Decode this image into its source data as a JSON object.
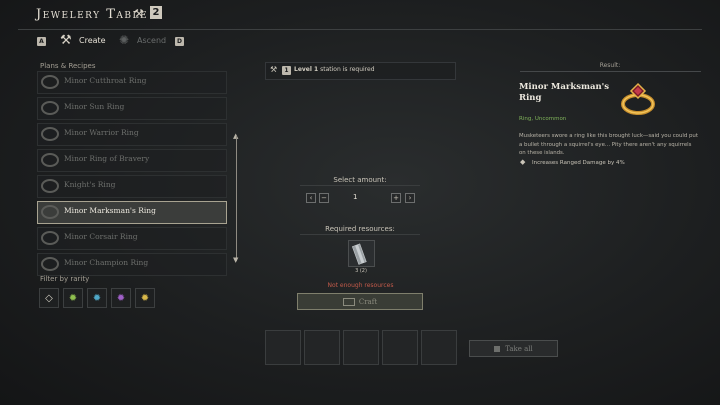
{
  "header": {
    "title": "Jewelery Table",
    "station_icon": "anvil-icon",
    "station_level": "2"
  },
  "tabs": {
    "left_key": "A",
    "right_key": "D",
    "create": {
      "label": "Create",
      "icon": "hammer-icon"
    },
    "ascend": {
      "label": "Ascend",
      "icon": "ascend-sun-icon"
    }
  },
  "plans": {
    "label": "Plans & Recipes",
    "items": [
      {
        "label": "Minor Cutthroat Ring",
        "selected": false
      },
      {
        "label": "Minor Sun Ring",
        "selected": false
      },
      {
        "label": "Minor Warrior Ring",
        "selected": false
      },
      {
        "label": "Minor Ring of Bravery",
        "selected": false
      },
      {
        "label": "Knight's Ring",
        "selected": false
      },
      {
        "label": "Minor Marksman's Ring",
        "selected": true
      },
      {
        "label": "Minor Corsair Ring",
        "selected": false
      },
      {
        "label": "Minor Champion Ring",
        "selected": false
      }
    ]
  },
  "filter": {
    "label": "Filter by rarity",
    "rarities": [
      {
        "name": "common",
        "color": "#d8d4c8"
      },
      {
        "name": "uncommon",
        "color": "#8fbf4f"
      },
      {
        "name": "rare",
        "color": "#4fa8c8"
      },
      {
        "name": "epic",
        "color": "#a060c8"
      },
      {
        "name": "legendary",
        "color": "#d8b84a"
      }
    ]
  },
  "station_req": {
    "badge": "1",
    "level_text": "Level 1",
    "rest_text": " station is required"
  },
  "amount": {
    "label": "Select amount:",
    "value": "1"
  },
  "resources": {
    "label": "Required resources:",
    "count": "3 (2)",
    "warning": "Not enough resources"
  },
  "craft": {
    "label": "Craft"
  },
  "take_all": {
    "label": "Take all"
  },
  "result": {
    "label": "Result:",
    "name": "Minor Marksman's Ring",
    "subtitle": "Ring, Uncommon",
    "description": "Musketeers swore a ring like this brought luck—said you could put a bullet through a squirrel's eye... Pity there aren't any squirrels on these islands.",
    "bonus": "Increases Ranged Damage by 4%",
    "colors": {
      "uncommon": "#7fb35a",
      "warning": "#c25a4a"
    }
  }
}
